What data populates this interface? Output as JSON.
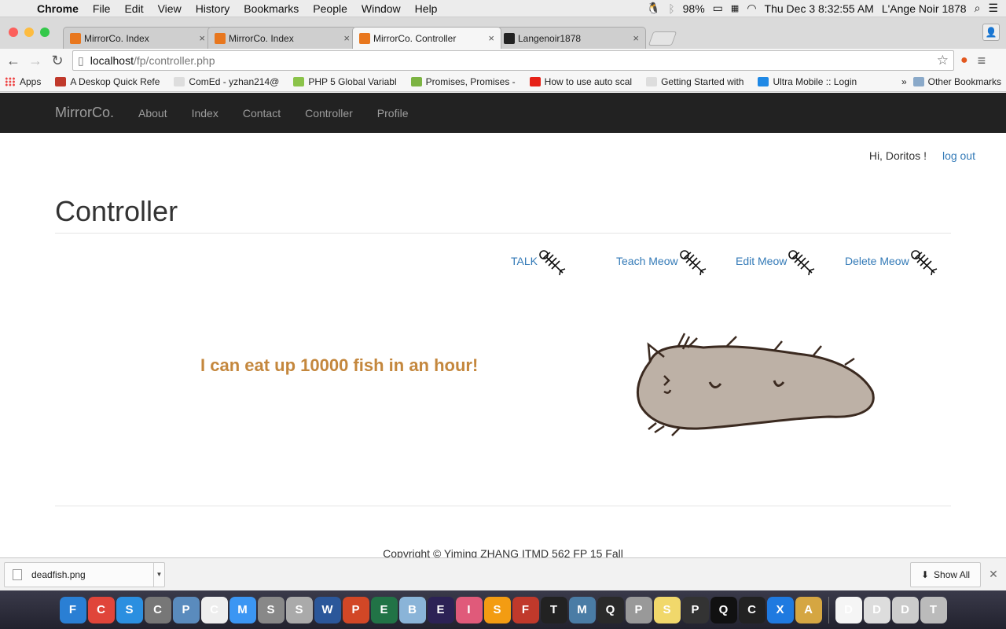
{
  "menubar": {
    "app_name": "Chrome",
    "items": [
      "File",
      "Edit",
      "View",
      "History",
      "Bookmarks",
      "People",
      "Window",
      "Help"
    ],
    "battery": "98%",
    "clock": "Thu Dec 3  8:32:55 AM",
    "user": "L'Ange Noir 1878"
  },
  "tabs": [
    {
      "title": "MirrorCo. Index",
      "favicon_color": "#e8771e",
      "active": false
    },
    {
      "title": "MirrorCo. Index",
      "favicon_color": "#e8771e",
      "active": false
    },
    {
      "title": "MirrorCo. Controller",
      "favicon_color": "#e8771e",
      "active": true
    },
    {
      "title": "Langenoir1878",
      "favicon_color": "#222222",
      "active": false
    }
  ],
  "omnibox": {
    "host": "localhost",
    "path": "/fp/controller.php"
  },
  "bookmarks": [
    {
      "label": "Apps",
      "color": "#e44"
    },
    {
      "label": "A Deskop Quick Refe",
      "color": "#c0392b"
    },
    {
      "label": "ComEd - yzhan214@",
      "color": "#dddddd"
    },
    {
      "label": "PHP 5 Global Variabl",
      "color": "#8bc34a"
    },
    {
      "label": "Promises, Promises -",
      "color": "#7cb342"
    },
    {
      "label": "How to use auto scal",
      "color": "#e62117"
    },
    {
      "label": "Getting Started with",
      "color": "#dddddd"
    },
    {
      "label": "Ultra Mobile :: Login",
      "color": "#1e88e5"
    }
  ],
  "bookmarks_more": "»",
  "bookmarks_other": "Other Bookmarks",
  "site": {
    "brand": "MirrorCo.",
    "nav": [
      "About",
      "Index",
      "Contact",
      "Controller",
      "Profile"
    ],
    "greeting": "Hi, Doritos !",
    "logout": "log out",
    "title": "Controller",
    "actions": [
      "TALK",
      "Teach Meow",
      "Edit Meow",
      "Delete Meow"
    ],
    "quote": "I can eat up 10000 fish in an hour!",
    "footer": "Copyright © Yiming ZHANG ITMD 562 FP 15 Fall"
  },
  "downloads": {
    "file": "deadfish.png",
    "show_all": "Show All"
  },
  "dock_apps": [
    "Finder",
    "Chrome",
    "Safari",
    "Calc",
    "Preview",
    "Calendar",
    "Messages",
    "System",
    "Sequel",
    "Word",
    "PowerPoint",
    "Excel",
    "Box",
    "Eclipse",
    "IntelliJ",
    "Sublime",
    "FileZilla",
    "Terminal",
    "MySQL",
    "QuickTime",
    "Preferences",
    "Stickies",
    "Printer",
    "QQ",
    "Console",
    "Xcode",
    "Archive",
    "Docs",
    "Desktop",
    "Downloads",
    "Trash"
  ]
}
